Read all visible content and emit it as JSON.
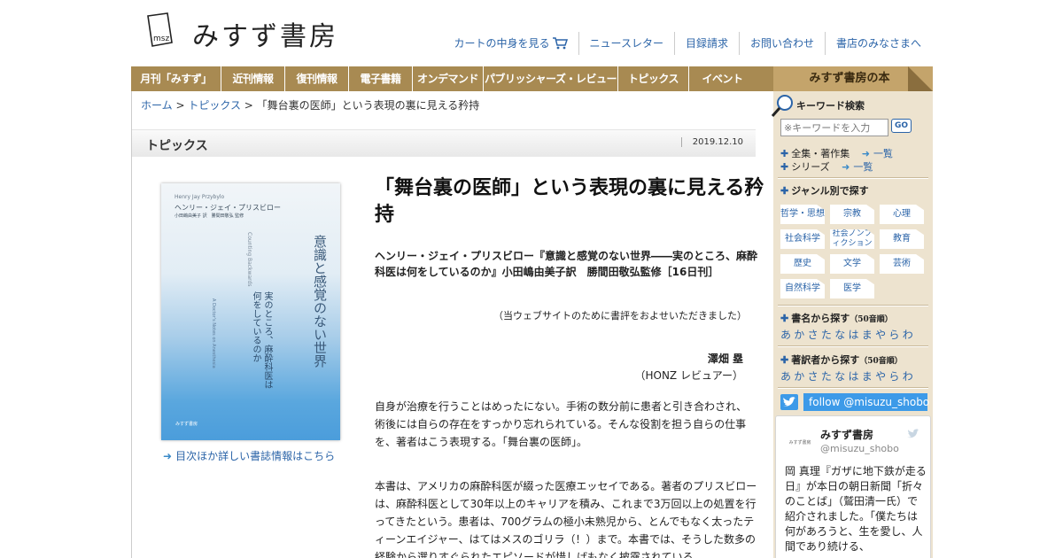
{
  "header": {
    "logo_mark": "msz",
    "logo_text": "みすず書房",
    "links": [
      "カートの中身を見る",
      "ニュースレター",
      "目録請求",
      "お問い合わせ",
      "書店のみなさまへ"
    ]
  },
  "nav": {
    "items": [
      "月刊「みすず」",
      "近刊情報",
      "復刊情報",
      "電子書籍",
      "オンデマンド",
      "パブリッシャーズ・レビュー",
      "トピックス",
      "イベント"
    ],
    "side_tab": "みすず書房の本"
  },
  "breadcrumb": {
    "home": "ホーム",
    "sep1": " > ",
    "section": "トピックス",
    "sep2": " > ",
    "current": "「舞台裏の医師」という表現の裏に見える矜持"
  },
  "topics_bar": {
    "label": "トピックス",
    "date": "2019.12.10"
  },
  "book_cover": {
    "author_en": "Henry Jay Przybylo",
    "author_ja": "ヘンリー・ジェイ・プリスビロー",
    "translator": "小田嶋由美子 訳　勝間田敬弘 監修",
    "title": "意識と感覚のない世界",
    "subtitle": "実のところ、麻酔科医は何をしているのか",
    "title_en": "Counting Backwards",
    "subtitle_en": "A Doctor's Notes on Anesthesia",
    "publisher": "みすず書房"
  },
  "book_detail_link": "目次ほか詳しい書誌情報はこちら",
  "article": {
    "title": "「舞台裏の医師」という表現の裏に見える矜持",
    "book_info": "ヘンリー・ジェイ・プリスビロー『意識と感覚のない世界――実のところ、麻酔科医は何をしているのか』小田嶋由美子訳　勝間田敬弘監修［16日刊］",
    "note": "（当ウェブサイトのために書評をおよせいただきました）",
    "reviewer": "澤畑 塁",
    "reviewer_org": "（HONZ レビュアー）",
    "para1": "自身が治療を行うことはめったにない。手術の数分前に患者と引き合わされ、術後には自らの存在をすっかり忘れられている。そんな役割を担う自らの仕事を、著者はこう表現する。「舞台裏の医師」。",
    "para2": "本書は、アメリカの麻酔科医が綴った医療エッセイである。著者のプリスビローは、麻酔科医として30年以上のキャリアを積み、これまで3万回以上の処置を行ってきたという。患者は、700グラムの極小未熟児から、とんでもなく太ったティーンエイジャー、はてはメスのゴリラ（！）まで。本書では、そうした数多の経験から選りすぐられたエピソードが惜しげもなく披露されている。"
  },
  "sidebar": {
    "keyword_title": "キーワード検索",
    "keyword_placeholder": "※キーワードを入力",
    "go": "GO",
    "row1_a": "全集・著作集",
    "row1_b": "一覧",
    "row2_a": "シリーズ",
    "row2_b": "一覧",
    "genre_title": "ジャンル別で探す",
    "genres": [
      "哲学・思想",
      "宗教",
      "心理",
      "社会科学",
      "社会ノンフィクション",
      "教育",
      "歴史",
      "文学",
      "芸術",
      "自然科学",
      "医学"
    ],
    "title_search": "書名から探す",
    "title_search_note": "（50音順）",
    "kana1": "あかさたなはまやらわ",
    "author_search": "著訳者から探す",
    "author_search_note": "（50音順）",
    "kana2": "あかさたなはまやらわ",
    "twitter_follow": "follow @misuzu_shobo",
    "tweet": {
      "avatar": "みすず書房",
      "name": "みすず書房",
      "handle": "@misuzu_shobo",
      "text": "岡 真理『ガザに地下鉄が走る日』が本日の朝日新聞「折々のことば」（鷲田清一氏）で紹介されました。「僕たちは何があろうと、生を愛し、人間であり続ける、"
    }
  }
}
